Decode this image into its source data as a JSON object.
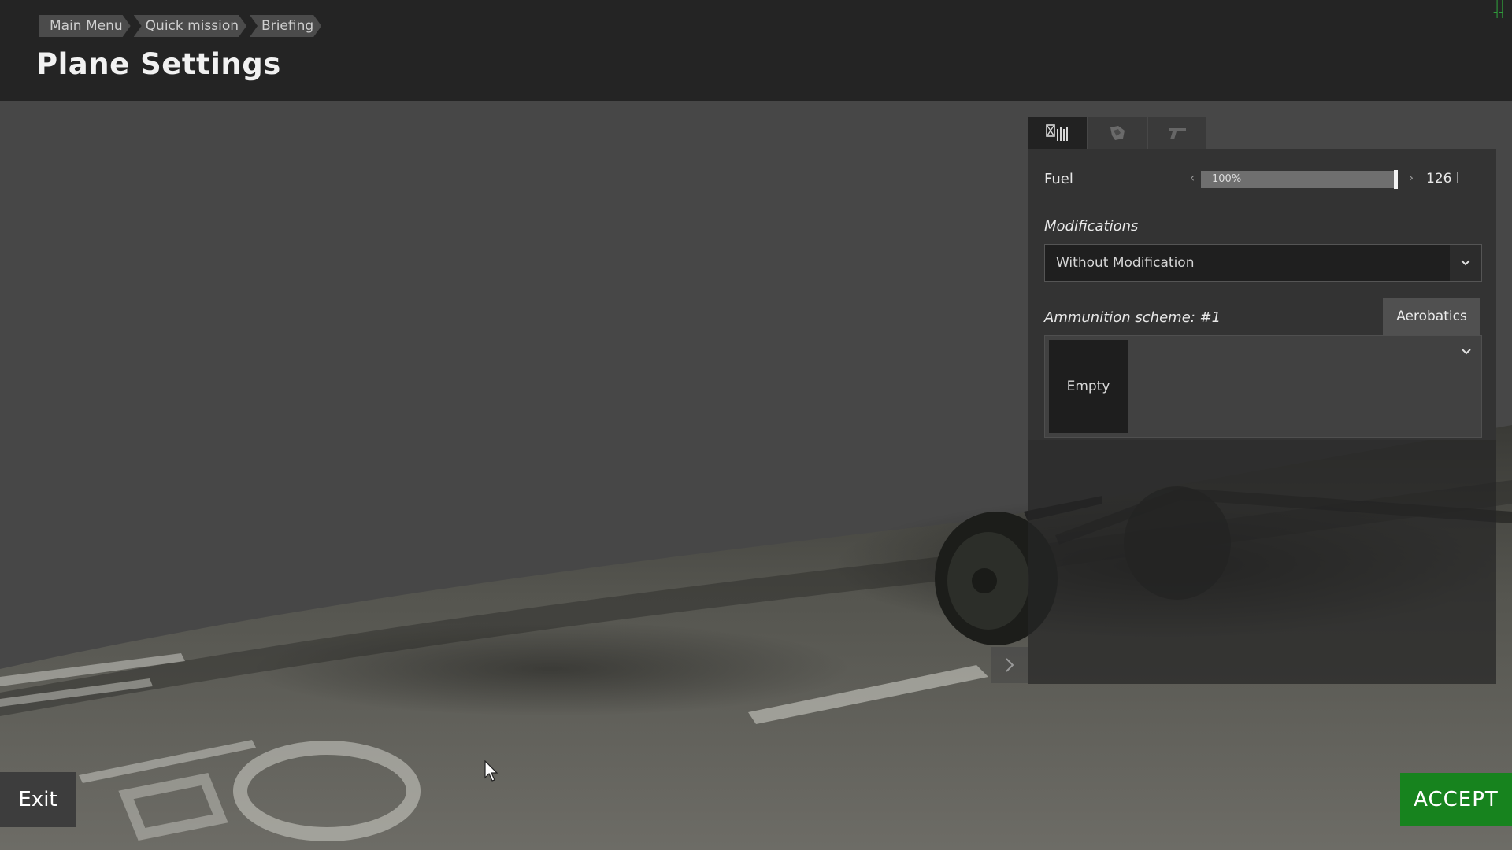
{
  "header": {
    "breadcrumb": [
      "Main Menu",
      "Quick mission",
      "Briefing"
    ],
    "title": "Plane Settings"
  },
  "panel": {
    "tabs": [
      {
        "icon": "loadout-icon",
        "active": true
      },
      {
        "icon": "camouflage-icon",
        "active": false
      },
      {
        "icon": "weapon-icon",
        "active": false
      }
    ],
    "fuel": {
      "label": "Fuel",
      "percent": "100%",
      "level": 1.0,
      "liters": "126 l"
    },
    "modifications": {
      "label": "Modifications",
      "selected": "Without Modification"
    },
    "ammunition": {
      "label": "Ammunition scheme: #1",
      "slot": "Empty",
      "preset_button": "Aerobatics"
    }
  },
  "buttons": {
    "exit": "Exit",
    "accept": "ACCEPT"
  },
  "colors": {
    "accept": "#17831e",
    "header_bg": "#242424",
    "panel_bg": "#333333"
  }
}
